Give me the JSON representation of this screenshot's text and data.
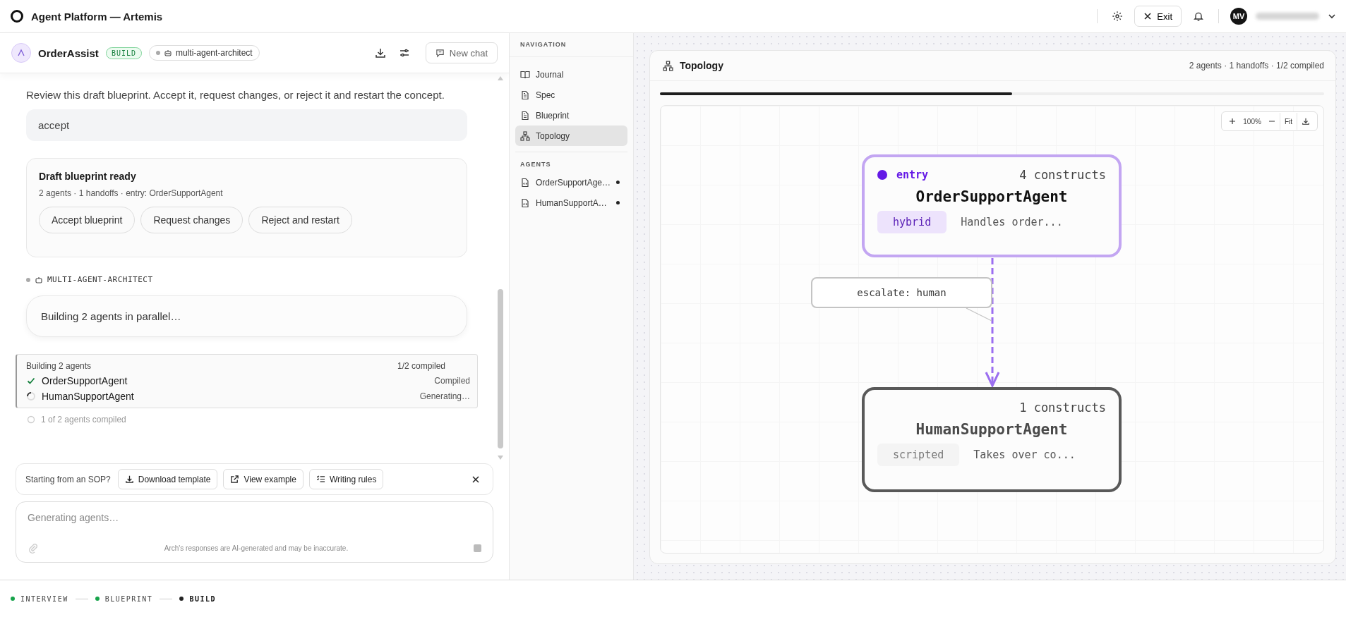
{
  "app": {
    "title": "Agent Platform — Artemis",
    "exit": "Exit",
    "avatar": "MV"
  },
  "chat": {
    "agent_name": "OrderAssist",
    "badge": "BUILD",
    "architect_chip": "multi-agent-architect",
    "new_chat": "New chat",
    "prompt": "Review this draft blueprint. Accept it, request changes, or reject it and restart the concept.",
    "user_reply": "accept",
    "blueprint_card": {
      "title": "Draft blueprint ready",
      "meta": "2 agents · 1 handoffs · entry: OrderSupportAgent",
      "actions": [
        "Accept blueprint",
        "Request changes",
        "Reject and restart"
      ]
    },
    "author": "MULTI-AGENT-ARCHITECT",
    "message": "Building 2 agents in parallel…",
    "build": {
      "title": "Building 2 agents",
      "count": "1/2 compiled",
      "agents": [
        {
          "name": "OrderSupportAgent",
          "status": "Compiled",
          "done": true
        },
        {
          "name": "HumanSupportAgent",
          "status": "Generating…",
          "done": false
        }
      ],
      "summary": "1 of 2 agents compiled"
    },
    "sop": {
      "label": "Starting from an SOP?",
      "buttons": [
        {
          "label": "Download template",
          "kind": "download"
        },
        {
          "label": "View example",
          "kind": "external"
        },
        {
          "label": "Writing rules",
          "kind": "list"
        }
      ]
    },
    "composer": {
      "placeholder": "Generating agents…",
      "disclaimer": "Arch's responses are AI-generated and may be inaccurate."
    }
  },
  "navigation": {
    "heading": "NAVIGATION",
    "items": [
      {
        "label": "Journal",
        "kind": "book",
        "selected": false
      },
      {
        "label": "Spec",
        "kind": "doc",
        "selected": false
      },
      {
        "label": "Blueprint",
        "kind": "doc",
        "selected": false
      },
      {
        "label": "Topology",
        "kind": "tree",
        "selected": true
      }
    ],
    "agents_heading": "AGENTS",
    "agents": [
      {
        "label": "OrderSupportAge…"
      },
      {
        "label": "HumanSupportA…"
      }
    ]
  },
  "topology": {
    "title": "Topology",
    "summary": "2 agents · 1 handoffs · 1/2 compiled",
    "progress": {
      "level": 0.53
    },
    "zoom": "100%",
    "fit": "Fit",
    "nodes": [
      {
        "kind": "entry",
        "tag": "entry",
        "constructs": "4 constructs",
        "name": "OrderSupportAgent",
        "type": "hybrid",
        "description": "Handles order..."
      },
      {
        "kind": "agent",
        "constructs": "1 constructs",
        "name": "HumanSupportAgent",
        "type": "scripted",
        "description": "Takes over co..."
      }
    ],
    "edge_label": "escalate: human"
  },
  "steps": [
    {
      "label": "INTERVIEW",
      "done": true
    },
    {
      "label": "BLUEPRINT",
      "done": true
    },
    {
      "label": "BUILD",
      "done": false
    }
  ]
}
